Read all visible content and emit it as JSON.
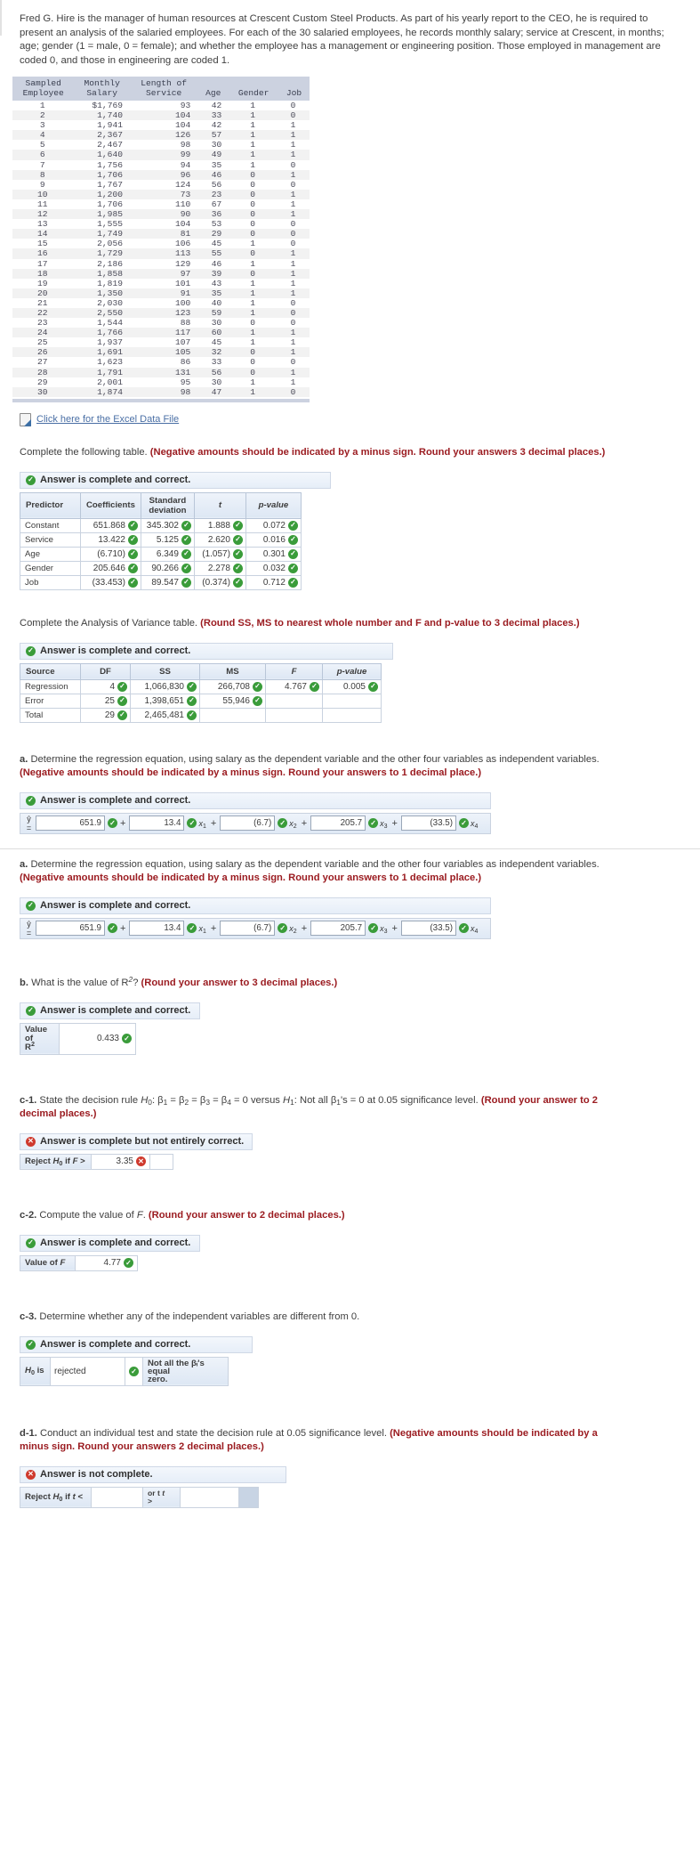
{
  "intro": {
    "paragraph": "Fred G. Hire is the manager of human resources at Crescent Custom Steel Products. As part of his yearly report to the CEO, he is required to present an analysis of the salaried employees. For each of the 30 salaried employees, he records monthly salary; service at Crescent, in months; age; gender (1 = male, 0 = female); and whether the employee has a management or engineering position. Those employed in management are coded 0, and those in engineering are coded 1."
  },
  "excel_link": {
    "label": "Click here for the Excel Data File",
    "icon": "excel-file-icon"
  },
  "data_table": {
    "headers": [
      {
        "l1": "Sampled",
        "l2": "Employee"
      },
      {
        "l1": "Monthly",
        "l2": "Salary"
      },
      {
        "l1": "Length of",
        "l2": "Service"
      },
      {
        "l1": "",
        "l2": "Age"
      },
      {
        "l1": "",
        "l2": "Gender"
      },
      {
        "l1": "",
        "l2": "Job"
      }
    ],
    "rows": [
      [
        "1",
        "$1,769",
        "93",
        "42",
        "1",
        "0"
      ],
      [
        "2",
        "1,740",
        "104",
        "33",
        "1",
        "0"
      ],
      [
        "3",
        "1,941",
        "104",
        "42",
        "1",
        "1"
      ],
      [
        "4",
        "2,367",
        "126",
        "57",
        "1",
        "1"
      ],
      [
        "5",
        "2,467",
        "98",
        "30",
        "1",
        "1"
      ],
      [
        "6",
        "1,640",
        "99",
        "49",
        "1",
        "1"
      ],
      [
        "7",
        "1,756",
        "94",
        "35",
        "1",
        "0"
      ],
      [
        "8",
        "1,706",
        "96",
        "46",
        "0",
        "1"
      ],
      [
        "9",
        "1,767",
        "124",
        "56",
        "0",
        "0"
      ],
      [
        "10",
        "1,200",
        "73",
        "23",
        "0",
        "1"
      ],
      [
        "11",
        "1,706",
        "110",
        "67",
        "0",
        "1"
      ],
      [
        "12",
        "1,985",
        "90",
        "36",
        "0",
        "1"
      ],
      [
        "13",
        "1,555",
        "104",
        "53",
        "0",
        "0"
      ],
      [
        "14",
        "1,749",
        "81",
        "29",
        "0",
        "0"
      ],
      [
        "15",
        "2,056",
        "106",
        "45",
        "1",
        "0"
      ],
      [
        "16",
        "1,729",
        "113",
        "55",
        "0",
        "1"
      ],
      [
        "17",
        "2,186",
        "129",
        "46",
        "1",
        "1"
      ],
      [
        "18",
        "1,858",
        "97",
        "39",
        "0",
        "1"
      ],
      [
        "19",
        "1,819",
        "101",
        "43",
        "1",
        "1"
      ],
      [
        "20",
        "1,350",
        "91",
        "35",
        "1",
        "1"
      ],
      [
        "21",
        "2,030",
        "100",
        "40",
        "1",
        "0"
      ],
      [
        "22",
        "2,550",
        "123",
        "59",
        "1",
        "0"
      ],
      [
        "23",
        "1,544",
        "88",
        "30",
        "0",
        "0"
      ],
      [
        "24",
        "1,766",
        "117",
        "60",
        "1",
        "1"
      ],
      [
        "25",
        "1,937",
        "107",
        "45",
        "1",
        "1"
      ],
      [
        "26",
        "1,691",
        "105",
        "32",
        "0",
        "1"
      ],
      [
        "27",
        "1,623",
        "86",
        "33",
        "0",
        "0"
      ],
      [
        "28",
        "1,791",
        "131",
        "56",
        "0",
        "1"
      ],
      [
        "29",
        "2,001",
        "95",
        "30",
        "1",
        "1"
      ],
      [
        "30",
        "1,874",
        "98",
        "47",
        "1",
        "0"
      ]
    ]
  },
  "section_coeff": {
    "prompt_plain": "Complete the following table. ",
    "prompt_red": "(Negative amounts should be indicated by a minus sign. Round your answers 3 decimal places.)",
    "status": "Answer is complete and correct.",
    "status_icon": "check-circle-icon",
    "headers": [
      "Predictor",
      "Coefficients",
      "Standard deviation",
      "t",
      "p-value"
    ],
    "rows": [
      {
        "predictor": "Constant",
        "coefficient": "651.868",
        "std": "345.302",
        "t": "1.888",
        "p": "0.072"
      },
      {
        "predictor": "Service",
        "coefficient": "13.422",
        "std": "5.125",
        "t": "2.620",
        "p": "0.016"
      },
      {
        "predictor": "Age",
        "coefficient": "(6.710)",
        "std": "6.349",
        "t": "(1.057)",
        "p": "0.301"
      },
      {
        "predictor": "Gender",
        "coefficient": "205.646",
        "std": "90.266",
        "t": "2.278",
        "p": "0.032"
      },
      {
        "predictor": "Job",
        "coefficient": "(33.453)",
        "std": "89.547",
        "t": "(0.374)",
        "p": "0.712"
      }
    ]
  },
  "section_anova": {
    "prompt_plain": "Complete the Analysis of Variance table. ",
    "prompt_red": "(Round SS, MS to nearest whole number and F and p-value to 3 decimal places.)",
    "status": "Answer is complete and correct.",
    "status_icon": "check-circle-icon",
    "headers": [
      "Source",
      "DF",
      "SS",
      "MS",
      "F",
      "p-value"
    ],
    "rows": [
      {
        "source": "Regression",
        "df": "4",
        "ss": "1,066,830",
        "ms": "266,708",
        "f": "4.767",
        "p": "0.005"
      },
      {
        "source": "Error",
        "df": "25",
        "ss": "1,398,651",
        "ms": "55,946",
        "f": "",
        "p": ""
      },
      {
        "source": "Total",
        "df": "29",
        "ss": "2,465,481",
        "ms": "",
        "f": "",
        "p": ""
      }
    ]
  },
  "section_a1": {
    "prompt_label": "a.",
    "prompt_plain": "Determine the regression equation, using salary as the dependent variable and the other four variables as independent variables. ",
    "prompt_red": "(Negative amounts should be indicated by a minus sign. Round your answers to 1 decimal place.)",
    "status": "Answer is complete and correct.",
    "status_icon": "check-circle-icon",
    "equation": {
      "yhat": "ŷ =",
      "intercept": "651.9",
      "terms": [
        {
          "op": "+",
          "coef": "13.4",
          "var": "x",
          "sub": "1"
        },
        {
          "op": "+",
          "coef": "(6.7)",
          "var": "x",
          "sub": "2"
        },
        {
          "op": "+",
          "coef": "205.7",
          "var": "x",
          "sub": "3"
        },
        {
          "op": "+",
          "coef": "(33.5)",
          "var": "x",
          "sub": "4"
        }
      ]
    }
  },
  "section_a2": {
    "prompt_label": "a.",
    "prompt_plain": "Determine the regression equation, using salary as the dependent variable and the other four variables as independent variables. ",
    "prompt_red": "(Negative amounts should be indicated by a minus sign. Round your answers to 1 decimal place.)",
    "status": "Answer is complete and correct.",
    "status_icon": "check-circle-icon",
    "equation": {
      "yhat": "ŷ =",
      "intercept": "651.9",
      "terms": [
        {
          "op": "+",
          "coef": "13.4",
          "var": "x",
          "sub": "1"
        },
        {
          "op": "+",
          "coef": "(6.7)",
          "var": "x",
          "sub": "2"
        },
        {
          "op": "+",
          "coef": "205.7",
          "var": "x",
          "sub": "3"
        },
        {
          "op": "+",
          "coef": "(33.5)",
          "var": "x",
          "sub": "4"
        }
      ]
    }
  },
  "section_b": {
    "prompt_label": "b.",
    "prompt_plain": "What is the value of R",
    "prompt_sup": "2",
    "prompt_tail": "? ",
    "prompt_red": "(Round your answer to 3 decimal places.)",
    "status": "Answer is complete and correct.",
    "status_icon": "check-circle-icon",
    "row_label_1": "Value of",
    "row_label_2": "R",
    "row_label_2_sup": "2",
    "value": "0.433"
  },
  "section_c1": {
    "prompt_label": "c-1.",
    "prompt_plain": "State the decision rule H",
    "prompt_text_full": "State the decision rule H₀: β₁ = β₂ = β₃ = β₄ = 0 versus H₁: Not all β₁'s = 0 at 0.05 significance level. ",
    "prompt_red": "(Round your answer to 2 decimal places.)",
    "status": "Answer is complete but not entirely correct.",
    "status_icon": "x-circle-icon",
    "row_label": "Reject H₀ if F >",
    "value": "3.35"
  },
  "section_c2": {
    "prompt_label": "c-2.",
    "prompt_plain": "Compute the value of F. ",
    "prompt_red": "(Round your answer to 2 decimal places.)",
    "status": "Answer is complete and correct.",
    "status_icon": "check-circle-icon",
    "row_label": "Value of F",
    "value": "4.77"
  },
  "section_c3": {
    "prompt_label": "c-3.",
    "prompt_plain": "Determine whether any of the independent variables are different from 0.",
    "status": "Answer is complete and correct.",
    "status_icon": "check-circle-icon",
    "row_label": "H₀ is",
    "value": "rejected",
    "conclusion_1": "Not all the βᵢ's equal",
    "conclusion_2": "zero."
  },
  "section_d1": {
    "prompt_label": "d-1.",
    "prompt_plain": "Conduct an individual test and state the decision rule at 0.05 significance level. ",
    "prompt_red": "(Negative amounts should be indicated by a minus sign. Round your answers 2 decimal places.)",
    "status": "Answer is not complete.",
    "status_icon": "x-circle-icon",
    "row_label": "Reject H₀ if t <",
    "mid_label_1": "or t",
    "mid_label_2": ">",
    "value_left": "",
    "value_right": ""
  },
  "colors": {
    "ok": "#3a9c3a",
    "bad": "#cf3a2e",
    "red_text": "#9b1c21",
    "header_blue": "#ccd2e0",
    "link": "#4a6fa5"
  }
}
